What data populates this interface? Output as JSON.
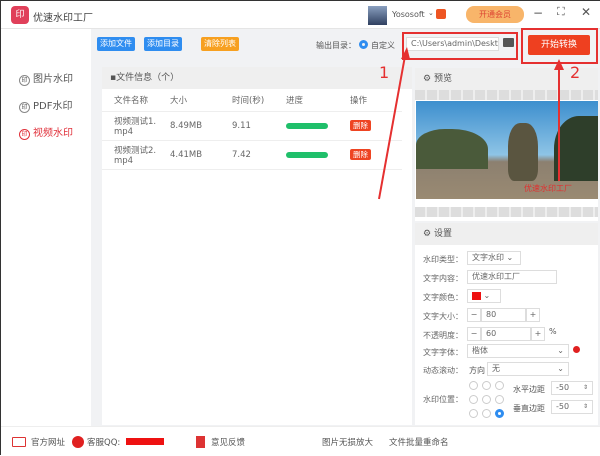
{
  "app": {
    "title": "优速水印工厂",
    "logo_text": "印",
    "user": "Yososoft",
    "vip_label": "开通会员"
  },
  "sidebar": {
    "items": [
      {
        "label": "图片水印"
      },
      {
        "label": "PDF水印"
      },
      {
        "label": "视频水印",
        "active": true
      }
    ]
  },
  "toolbar": {
    "add_file": "添加文件",
    "add_dir": "添加目录",
    "clear_list": "清除列表",
    "output_label": "输出目录：",
    "custom_label": "自定义",
    "output_path": "C:\\Users\\admin\\Desktop",
    "start": "开始转换"
  },
  "files": {
    "title": "文件信息（个）",
    "columns": [
      "文件名称",
      "大小",
      "时间(秒)",
      "进度",
      "操作"
    ],
    "rows": [
      {
        "name": "视频测试1.mp4",
        "size": "8.49MB",
        "time": "9.11",
        "progress": 100,
        "action": "删除"
      },
      {
        "name": "视频测试2.mp4",
        "size": "4.41MB",
        "time": "7.42",
        "progress": 100,
        "action": "删除"
      }
    ]
  },
  "preview": {
    "title": "预览",
    "watermark": "优速水印工厂"
  },
  "settings": {
    "title": "设置",
    "type_label": "水印类型：",
    "type_value": "文字水印",
    "content_label": "文字内容：",
    "content_value": "优速水印工厂",
    "color_label": "文字颜色：",
    "color_value": "#ee1111",
    "size_label": "文字大小：",
    "size_value": "80",
    "opacity_label": "不透明度：",
    "opacity_value": "60",
    "opacity_unit": "%",
    "font_label": "文字字体：",
    "font_value": "楷体",
    "scroll_label": "动态滚动：",
    "direction_label": "方向",
    "direction_value": "无",
    "position_label": "水印位置：",
    "h_margin_label": "水平边距",
    "h_margin_value": "-50",
    "v_margin_label": "垂直边距",
    "v_margin_value": "-50",
    "minus": "−",
    "plus": "+"
  },
  "footer": {
    "website": "官方网址",
    "qq": "客服QQ:",
    "feedback": "意见反馈",
    "link1": "图片无损放大",
    "link2": "文件批量重命名"
  },
  "annotations": {
    "one": "1",
    "two": "2"
  }
}
